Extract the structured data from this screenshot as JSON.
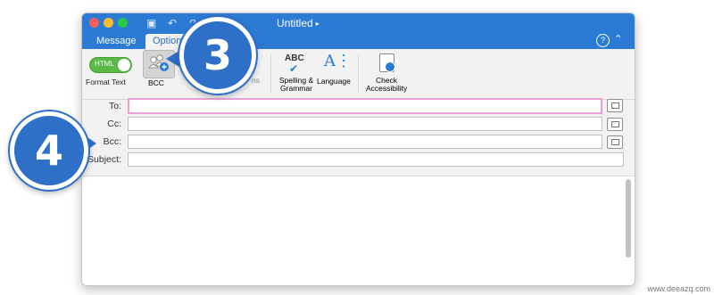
{
  "window": {
    "title": "Untitled"
  },
  "tabs": {
    "message": "Message",
    "options": "Options"
  },
  "ribbon": {
    "toggle_text": "HTML",
    "format_text_label": "Format Text",
    "bcc_label": "BCC",
    "permissions_label": "ns",
    "spelling_icon_text": "ABC",
    "spelling_label": "Spelling & Grammar",
    "language_label": "Language",
    "accessibility_label": "Check Accessibility"
  },
  "fields": {
    "to_label": "To:",
    "cc_label": "Cc:",
    "bcc_label": "Bcc:",
    "subject_label": "Subject:",
    "to_value": "",
    "cc_value": "",
    "bcc_value": "",
    "subject_value": ""
  },
  "callouts": {
    "three": "3",
    "four": "4"
  },
  "watermark": "www.deeazq.com",
  "colors": {
    "accent": "#2b7bd4",
    "callout": "#2e6fc7",
    "focus_border": "#e9a0d4"
  }
}
